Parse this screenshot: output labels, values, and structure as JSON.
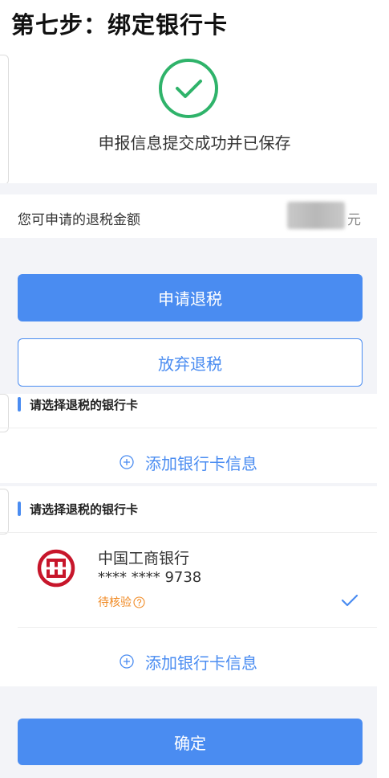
{
  "step_title": "第七步：绑定银行卡",
  "success": {
    "message": "申报信息提交成功并已保存"
  },
  "refund": {
    "label": "您可申请的退税金额",
    "unit": "元"
  },
  "buttons": {
    "apply": "申请退税",
    "abandon": "放弃退税",
    "confirm": "确定"
  },
  "section1": {
    "title": "请选择退税的银行卡",
    "add_label": "添加银行卡信息"
  },
  "section2": {
    "title": "请选择退税的银行卡",
    "bank": {
      "name": "中国工商银行",
      "number": "**** **** 9738",
      "status": "待核验"
    },
    "add_label": "添加银行卡信息"
  },
  "colors": {
    "accent": "#4a8cf1",
    "success": "#2fb36a",
    "warning": "#f08a24",
    "bank_red": "#c7162b"
  }
}
